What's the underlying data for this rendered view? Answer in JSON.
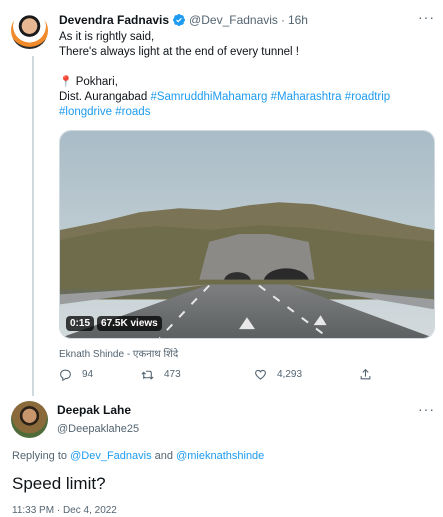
{
  "tweet": {
    "author_name": "Devendra Fadnavis",
    "author_handle": "@Dev_Fadnavis",
    "separator": "·",
    "time": "16h",
    "more": "···",
    "line1": "As it is rightly said,",
    "line2": "There's always light at the end of every tunnel !",
    "location": "Pokhari,",
    "location2": "Dist. Aurangabad",
    "hashtags": [
      "#SamruddhiMahamarg",
      "#Maharashtra",
      "#roadtrip",
      "#longdrive",
      "#roads"
    ],
    "media": {
      "duration": "0:15",
      "views": "67.5K views",
      "credit": "Eknath Shinde - एकनाथ शिंदे"
    },
    "actions": {
      "replies": "94",
      "retweets": "473",
      "likes": "4,293"
    }
  },
  "reply": {
    "author_name": "Deepak Lahe",
    "author_handle": "@Deepaklahe25",
    "more": "···",
    "replying_prefix": "Replying to",
    "replying_to_1": "@Dev_Fadnavis",
    "replying_and": "and",
    "replying_to_2": "@mieknathshinde",
    "text": "Speed limit?",
    "timestamp": "11:33 PM · Dec 4, 2022"
  },
  "colors": {
    "link": "#1d9bf0",
    "muted": "#536471",
    "text": "#0f1419",
    "verified": "#1d9bf0"
  }
}
